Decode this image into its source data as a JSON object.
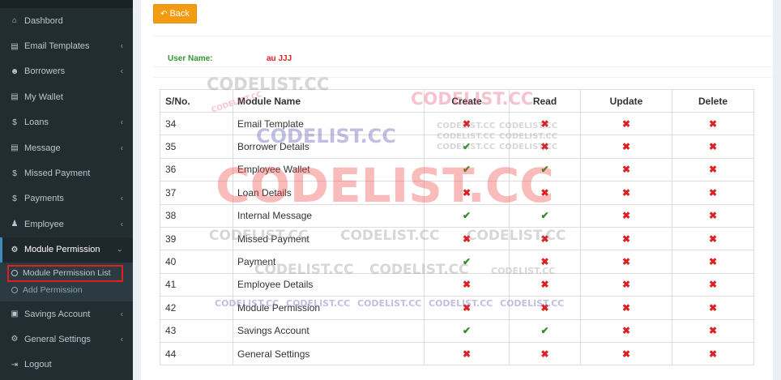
{
  "sidebar": {
    "items": [
      {
        "label": "Dashbord",
        "icon": "dashboard-icon",
        "glyph": "⌂",
        "has_children": false
      },
      {
        "label": "Email Templates",
        "icon": "book-icon",
        "glyph": "▤",
        "has_children": true
      },
      {
        "label": "Borrowers",
        "icon": "users-icon",
        "glyph": "☻",
        "has_children": true
      },
      {
        "label": "My Wallet",
        "icon": "book-icon",
        "glyph": "▤",
        "has_children": false
      },
      {
        "label": "Loans",
        "icon": "dollar-icon",
        "glyph": "$",
        "has_children": true
      },
      {
        "label": "Message",
        "icon": "book-icon",
        "glyph": "▤",
        "has_children": true
      },
      {
        "label": "Missed Payment",
        "icon": "dollar-icon",
        "glyph": "$",
        "has_children": false
      },
      {
        "label": "Payments",
        "icon": "dollar-icon",
        "glyph": "$",
        "has_children": true
      },
      {
        "label": "Employee",
        "icon": "user-icon",
        "glyph": "♟",
        "has_children": true
      }
    ],
    "active_item": {
      "label": "Module Permission",
      "icon": "cogs-icon",
      "glyph": "⚙"
    },
    "submenu": [
      {
        "label": "Module Permission List",
        "current": true
      },
      {
        "label": "Add Permission",
        "current": false
      }
    ],
    "items_after": [
      {
        "label": "Savings Account",
        "icon": "money-icon",
        "glyph": "▣",
        "has_children": true
      },
      {
        "label": "General Settings",
        "icon": "gear-icon",
        "glyph": "⚙",
        "has_children": true
      },
      {
        "label": "Logout",
        "icon": "logout-icon",
        "glyph": "⇥",
        "has_children": false
      }
    ],
    "chevron_left": "‹",
    "chevron_down": "⌄"
  },
  "toolbar": {
    "back_label": "Back",
    "back_icon": "reply-icon"
  },
  "user": {
    "label": "User Name:",
    "value": "au JJJ"
  },
  "table": {
    "headers": [
      "S/No.",
      "Module Name",
      "Create",
      "Read",
      "Update",
      "Delete"
    ],
    "rows": [
      {
        "sno": "34",
        "name": "Email Template",
        "create": false,
        "read": false,
        "update": false,
        "delete": false
      },
      {
        "sno": "35",
        "name": "Borrower Details",
        "create": true,
        "read": false,
        "update": false,
        "delete": false
      },
      {
        "sno": "36",
        "name": "Employee Wallet",
        "create": true,
        "read": true,
        "update": false,
        "delete": false
      },
      {
        "sno": "37",
        "name": "Loan Details",
        "create": false,
        "read": false,
        "update": false,
        "delete": false
      },
      {
        "sno": "38",
        "name": "Internal Message",
        "create": true,
        "read": true,
        "update": false,
        "delete": false
      },
      {
        "sno": "39",
        "name": "Missed Payment",
        "create": false,
        "read": false,
        "update": false,
        "delete": false
      },
      {
        "sno": "40",
        "name": "Payment",
        "create": true,
        "read": false,
        "update": false,
        "delete": false
      },
      {
        "sno": "41",
        "name": "Employee Details",
        "create": false,
        "read": false,
        "update": false,
        "delete": false
      },
      {
        "sno": "42",
        "name": "Module Permission",
        "create": false,
        "read": false,
        "update": false,
        "delete": false
      },
      {
        "sno": "43",
        "name": "Savings Account",
        "create": true,
        "read": true,
        "update": false,
        "delete": false
      },
      {
        "sno": "44",
        "name": "General Settings",
        "create": false,
        "read": false,
        "update": false,
        "delete": false
      }
    ],
    "yes_glyph": "✔",
    "no_glyph": "✖"
  },
  "colors": {
    "sidebar_bg": "#222d32",
    "back_button": "#f39c12",
    "yes": "#2e8b2e",
    "no": "#dd2020",
    "highlight_border": "#e02020"
  },
  "watermark": {
    "text": "CODELIST.CC"
  }
}
